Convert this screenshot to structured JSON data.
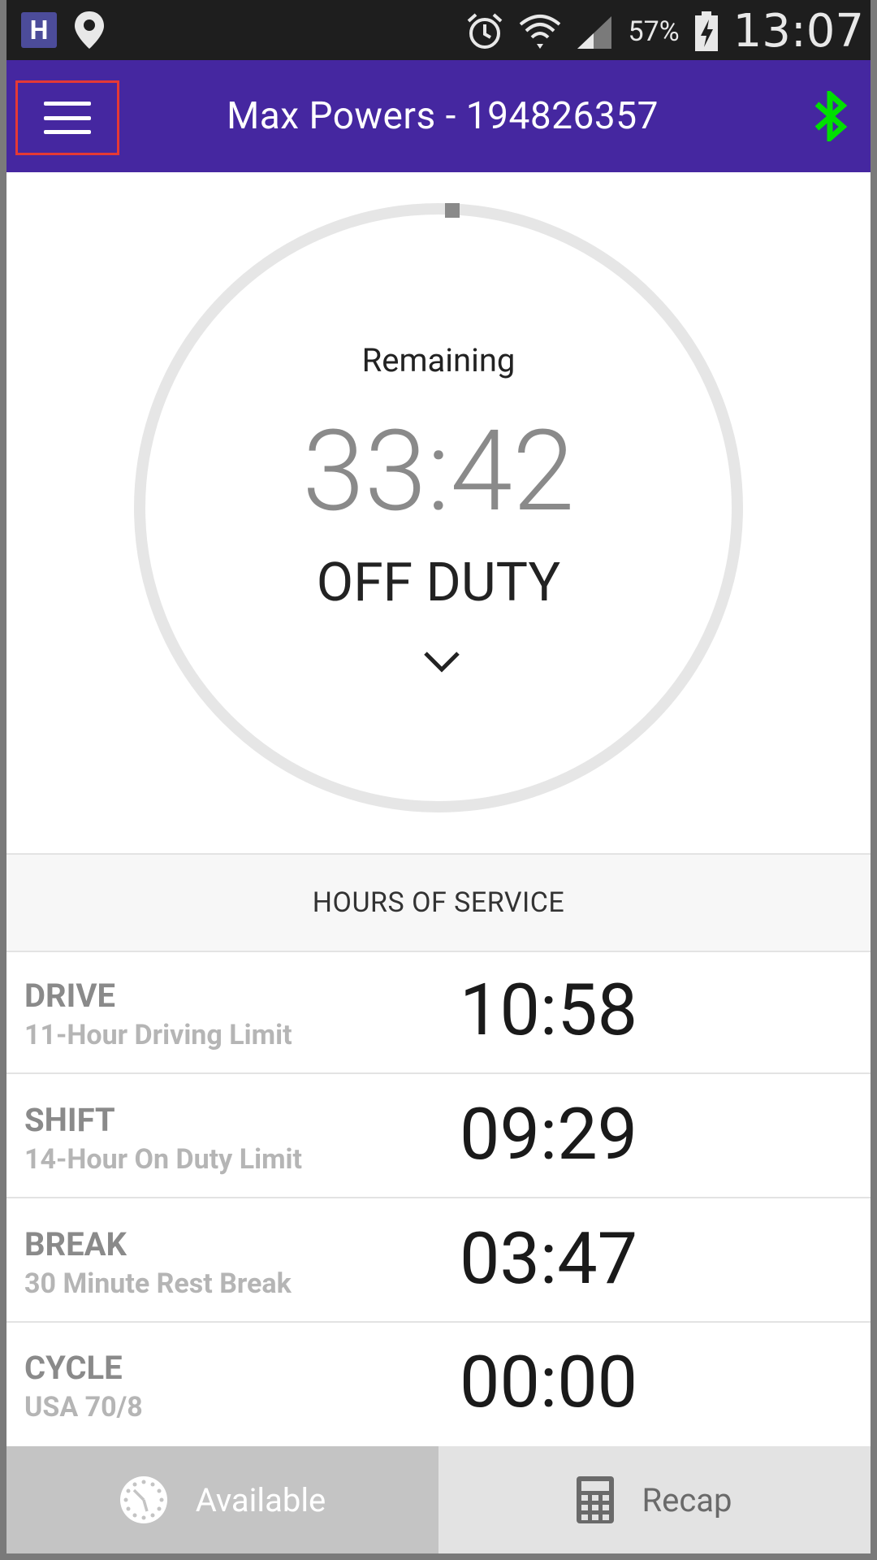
{
  "status_bar": {
    "app_badge": "H",
    "battery": "57%",
    "time": "13:07",
    "icons": [
      "h-app-icon",
      "location-pin-icon",
      "alarm-icon",
      "wifi-icon",
      "signal-icon",
      "battery-charging-icon"
    ]
  },
  "header": {
    "title": "Max Powers - 194826357",
    "menu_icon": "hamburger-menu-icon",
    "bluetooth_icon": "bluetooth-icon",
    "bluetooth_color": "#00e000",
    "background": "#4527a0"
  },
  "dial": {
    "label": "Remaining",
    "value": "33:42",
    "status": "OFF DUTY",
    "chevron_icon": "chevron-down-icon"
  },
  "hours_of_service": {
    "title": "HOURS OF SERVICE",
    "rows": [
      {
        "name": "DRIVE",
        "sub": "11-Hour Driving Limit",
        "time": "10:58"
      },
      {
        "name": "SHIFT",
        "sub": "14-Hour On Duty Limit",
        "time": "09:29"
      },
      {
        "name": "BREAK",
        "sub": "30 Minute Rest Break",
        "time": "03:47"
      },
      {
        "name": "CYCLE",
        "sub": "USA 70/8",
        "time": "00:00"
      }
    ]
  },
  "bottom_bar": {
    "available_label": "Available",
    "available_icon": "clock-icon",
    "recap_label": "Recap",
    "recap_icon": "calculator-icon"
  }
}
